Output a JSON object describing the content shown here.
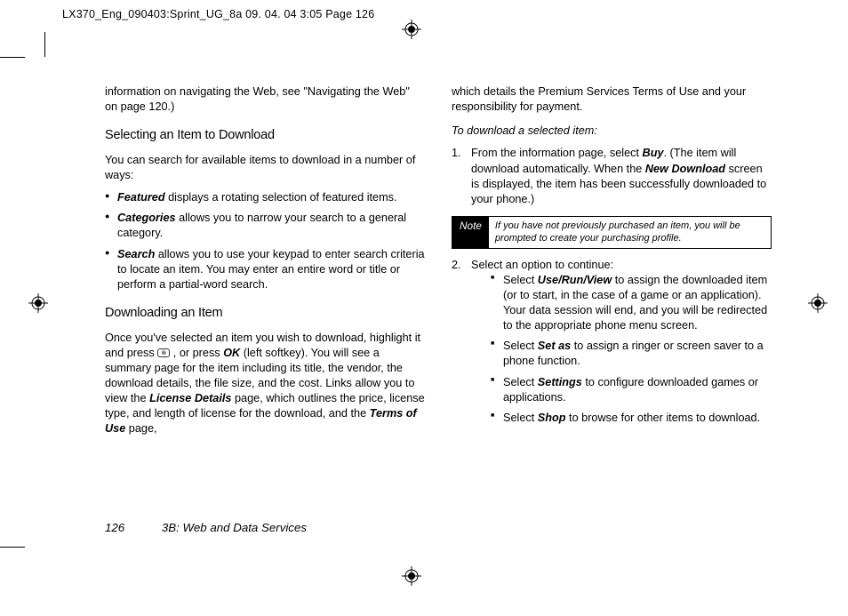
{
  "header": "LX370_Eng_090403:Sprint_UG_8a  09. 04. 04      3:05  Page 126",
  "col1": {
    "intro": "information on navigating the Web, see \"Navigating the Web\" on page 120.)",
    "h1": "Selecting an Item to Download",
    "p1": "You can search for available items to download in a number of ways:",
    "b1a": "Featured",
    "b1b": " displays a rotating selection of featured items.",
    "b2a": "Categories",
    "b2b": " allows you to narrow your search to a general category.",
    "b3a": "Search",
    "b3b": " allows you to use your keypad to enter search criteria to locate an item. You may enter an entire word or title or perform a partial-word search.",
    "h2": "Downloading an Item",
    "p2a": "Once you've selected an item you wish to download, highlight it and press ",
    "p2b": " , or press ",
    "p2c": "OK",
    "p2d": " (left softkey). You will see a summary page for the item including its title, the vendor, the download details, the file size, and the cost. Links allow you to view the ",
    "p2e": "License Details",
    "p2f": " page, which outlines the price, license type, and length of license for the download, and the ",
    "p2g": "Terms of Use",
    "p2h": " page,"
  },
  "col2": {
    "intro": "which details the Premium Services Terms of Use and your responsibility for payment.",
    "lead": "To download a selected item:",
    "s1n": "1.",
    "s1a": "From the information page, select ",
    "s1b": "Buy",
    "s1c": ". (The item will download automatically. When the ",
    "s1d": "New Download",
    "s1e": " screen is displayed, the item has been successfully downloaded to your phone.)",
    "noteLabel": "Note",
    "noteText": "If you have not previously purchased an item, you will be prompted to create your purchasing profile.",
    "s2n": "2.",
    "s2": "Select an option to continue:",
    "sq1a": "Select ",
    "sq1b": "Use/Run/View",
    "sq1c": " to assign the downloaded item (or to start, in the case of a game or an application). Your data session will end, and you will be redirected to the appropriate phone menu screen.",
    "sq2a": "Select ",
    "sq2b": "Set as",
    "sq2c": " to assign a ringer or screen saver to a phone function.",
    "sq3a": "Select ",
    "sq3b": "Settings",
    "sq3c": " to configure downloaded games or applications.",
    "sq4a": "Select ",
    "sq4b": "Shop",
    "sq4c": " to browse for other items to download."
  },
  "footer": {
    "page": "126",
    "section": "3B: Web and Data Services"
  }
}
